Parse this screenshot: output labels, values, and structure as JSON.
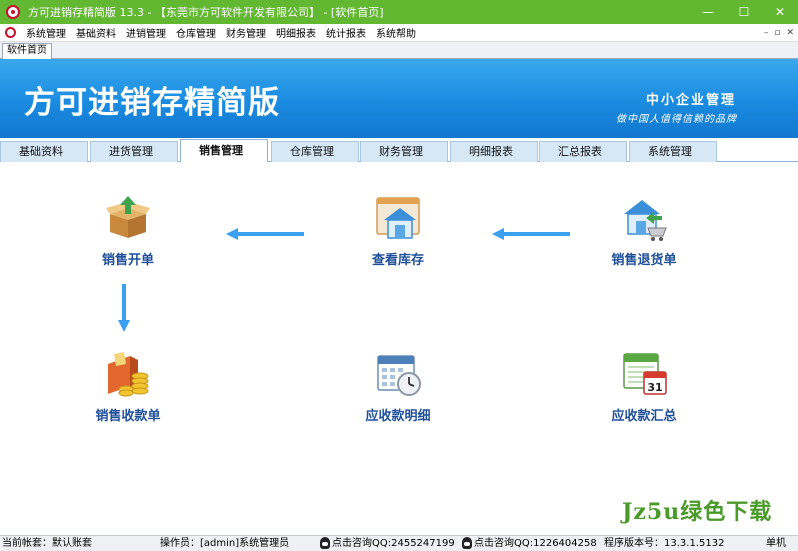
{
  "window": {
    "title": "方可进销存精简版 13.3 - 【东莞市方可软件开发有限公司】 - [软件首页]",
    "controls": {
      "minimize": "—",
      "maximize": "☐",
      "close": "✕"
    }
  },
  "menu": {
    "items": [
      "系统管理",
      "基础资料",
      "进销管理",
      "仓库管理",
      "财务管理",
      "明细报表",
      "统计报表",
      "系统帮助"
    ],
    "mdi_controls": {
      "minimize": "–",
      "restore": "▫",
      "close": "✕"
    }
  },
  "doc_tab": "软件首页",
  "banner": {
    "title": "方可进销存精简版",
    "slogan_1": "中小企业管理",
    "slogan_2": "做中国人值得信赖的品牌"
  },
  "tabs": [
    "基础资料",
    "进货管理",
    "销售管理",
    "仓库管理",
    "财务管理",
    "明细报表",
    "汇总报表",
    "系统管理"
  ],
  "active_tab_index": 2,
  "functions": {
    "sales_order": {
      "label": "销售开单",
      "icon": "open-box-icon"
    },
    "check_stock": {
      "label": "查看库存",
      "icon": "warehouse-icon"
    },
    "sales_return": {
      "label": "销售退货单",
      "icon": "return-cart-icon"
    },
    "sales_receipt": {
      "label": "销售收款单",
      "icon": "coins-icon"
    },
    "receivable_detail": {
      "label": "应收款明细",
      "icon": "calendar-clock-icon"
    },
    "receivable_summary": {
      "label": "应收款汇总",
      "icon": "calendar-31-icon"
    },
    "calendar_day": "31"
  },
  "watermark": "Jz5u绿色下载",
  "status": {
    "account": "当前帐套：默认账套",
    "operator": "操作员：[admin]系统管理员",
    "qq1": "点击咨询QQ:2455247199",
    "qq2": "点击咨询QQ:1226404258",
    "version": "程序版本号：13.3.1.5132",
    "edition": "单机"
  },
  "colors": {
    "titlebar": "#63b832",
    "banner": "#1a8be0",
    "tab_inactive": "#d6e7f6",
    "label": "#1f4f9a",
    "arrow": "#3aa0ef"
  }
}
